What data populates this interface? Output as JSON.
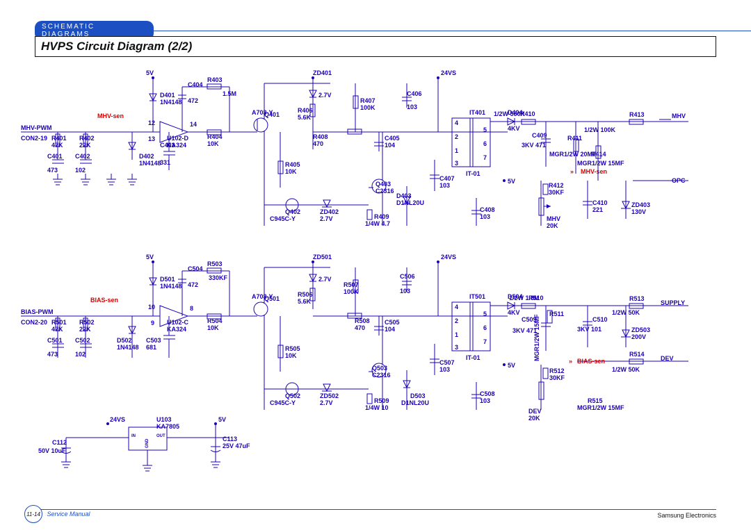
{
  "header": {
    "tag": "SCHEMATIC DIAGRAMS"
  },
  "title": "HVPS Circuit Diagram (2/2)",
  "footer": {
    "page": "11-14",
    "note": "Service Manual",
    "brand": "Samsung Electronics"
  },
  "labels": {
    "l5v_1": "5V",
    "d401": "D401",
    "d401v": "1N4148",
    "c404": "C404",
    "c404v": "472",
    "r403": "R403",
    "r403v": "1.5M",
    "mhvsen": "MHV-sen",
    "mhvpwm": "MHV-PWM",
    "con219": "CON2-19",
    "r401": "R401",
    "r401v": "47K",
    "r402": "R402",
    "r402v": "22K",
    "c401": "C401",
    "c401v": "473",
    "c402": "C402",
    "c402v": "102",
    "d402": "D402",
    "d402v": "1N4148",
    "c403": "C403",
    "c403v": "331",
    "u102d": "U102-D",
    "ka324": "KA324",
    "p12": "12",
    "p13": "13",
    "p14": "14",
    "r404": "R404",
    "r404v": "10K",
    "q401": "Q401",
    "q401v": "A708-Y",
    "zd401": "ZD401",
    "zd401v": "2.7V",
    "r406": "R406",
    "r406v": "5.6K",
    "r407": "R407",
    "r407v": "100K",
    "r405": "R405",
    "r405v": "10K",
    "r408": "R408",
    "r408v": "470",
    "c405": "C405",
    "c405v": "104",
    "r409": "R409",
    "r409v": "1/4W 4.7",
    "q402": "Q402",
    "q402v": "C945C-Y",
    "zd402": "ZD402",
    "zd402v": "2.7V",
    "q403": "Q403",
    "q403v": "C2316",
    "d403": "D403",
    "d403v": "D1NL20U",
    "c406": "C406",
    "c406v": "103",
    "c407": "C407",
    "c407v": "103",
    "it401": "IT401",
    "it01": "IT-01",
    "v24vs": "24VS",
    "tp1": "1",
    "tp2": "2",
    "tp3": "3",
    "tp4": "4",
    "tp5": "5",
    "tp6": "6",
    "tp7": "7",
    "d404": "D404",
    "d404v": "4KV",
    "r410": "R410",
    "r410v": "1/2W 560K",
    "c409": "C409",
    "c409v": "3KV 471",
    "r411": "R411",
    "r411v": "MGR1/2W 20MF",
    "r413": "R413",
    "r413v": "1/2W 100K",
    "r414": "R414",
    "r414v": "MGR1/2W 15MF",
    "mhv": "MHV",
    "opc": "OPC",
    "mhvsen2": "MHV-sen",
    "r412": "R412",
    "r412v": "30KF",
    "c410": "C410",
    "c410v": "221",
    "zd403": "ZD403",
    "zd403v": "130V",
    "c408": "C408",
    "c408v": "103",
    "mhv2": "MHV",
    "mhv2v": "20K",
    "v5_2": "5V",
    "l5v_3": "5V",
    "d501": "D501",
    "d501v": "1N4148",
    "c504": "C504",
    "c504v": "472",
    "r503": "R503",
    "r503v": "330KF",
    "biassen": "BIAS-sen",
    "biaspwm": "BIAS-PWM",
    "con220": "CON2-20",
    "r501": "R501",
    "r501v": "47K",
    "r502": "R502",
    "r502v": "22K",
    "c501": "C501",
    "c501v": "473",
    "c502": "C502",
    "c502v": "102",
    "d502": "D502",
    "d502v": "1N4148",
    "c503": "C503",
    "c503v": "681",
    "u102c": "U102-C",
    "p10": "10",
    "p9": "9",
    "p8": "8",
    "r504": "R504",
    "r504v": "10K",
    "q501": "Q501",
    "q501v": "A708-Y",
    "zd501": "ZD501",
    "zd501v": "2.7V",
    "r506": "R506",
    "r506v": "5.6K",
    "r507": "R507",
    "r507v": "100K",
    "r505": "R505",
    "r505v": "10K",
    "r508": "R508",
    "r508v": "470",
    "c505": "C505",
    "c505v": "104",
    "r509": "R509",
    "r509v": "1/4W 10",
    "q502": "Q502",
    "q502v": "C945C-Y",
    "zd502": "ZD502",
    "zd502v": "2.7V",
    "q503": "Q503",
    "q503v": "C2316",
    "d503": "D503",
    "d503v": "D1NL20U",
    "c506": "C506",
    "c506v": "103",
    "c507": "C507",
    "c507v": "103",
    "it501": "IT501",
    "v24vs2": "24VS",
    "d504": "D504",
    "d504v": "4KV",
    "r510": "R510",
    "r510v": "1/2W 1.8M",
    "c509": "C509",
    "c509v": "3KV 471",
    "r511": "R511",
    "r513": "R513",
    "r513v": "1/2W 50K",
    "supply": "SUPPLY",
    "zd503": "ZD503",
    "zd503v": "200V",
    "c510": "C510",
    "c510v": "3KV 101",
    "r514": "R514",
    "r514v": "1/2W 50K",
    "dev": "DEV",
    "biassen2": "BIAS-sen",
    "r512": "R512",
    "r512v": "30KF",
    "r515": "R515",
    "r515v": "MGR1/2W 15MF",
    "mgr": "MGR1/2W 15MF",
    "dev2": "DEV",
    "dev2v": "20K",
    "c508": "C508",
    "c508v": "103",
    "v5_4": "5V",
    "v24vs3": "24VS",
    "u103": "U103",
    "u103v": "KA7805",
    "c112": "C112",
    "c112v": "50V 10uF",
    "c113": "C113",
    "c113v": "25V 47uF",
    "pin_in": "IN",
    "pin_out": "OUT",
    "pin_gnd": "GND",
    "l5v_5": "5V"
  }
}
